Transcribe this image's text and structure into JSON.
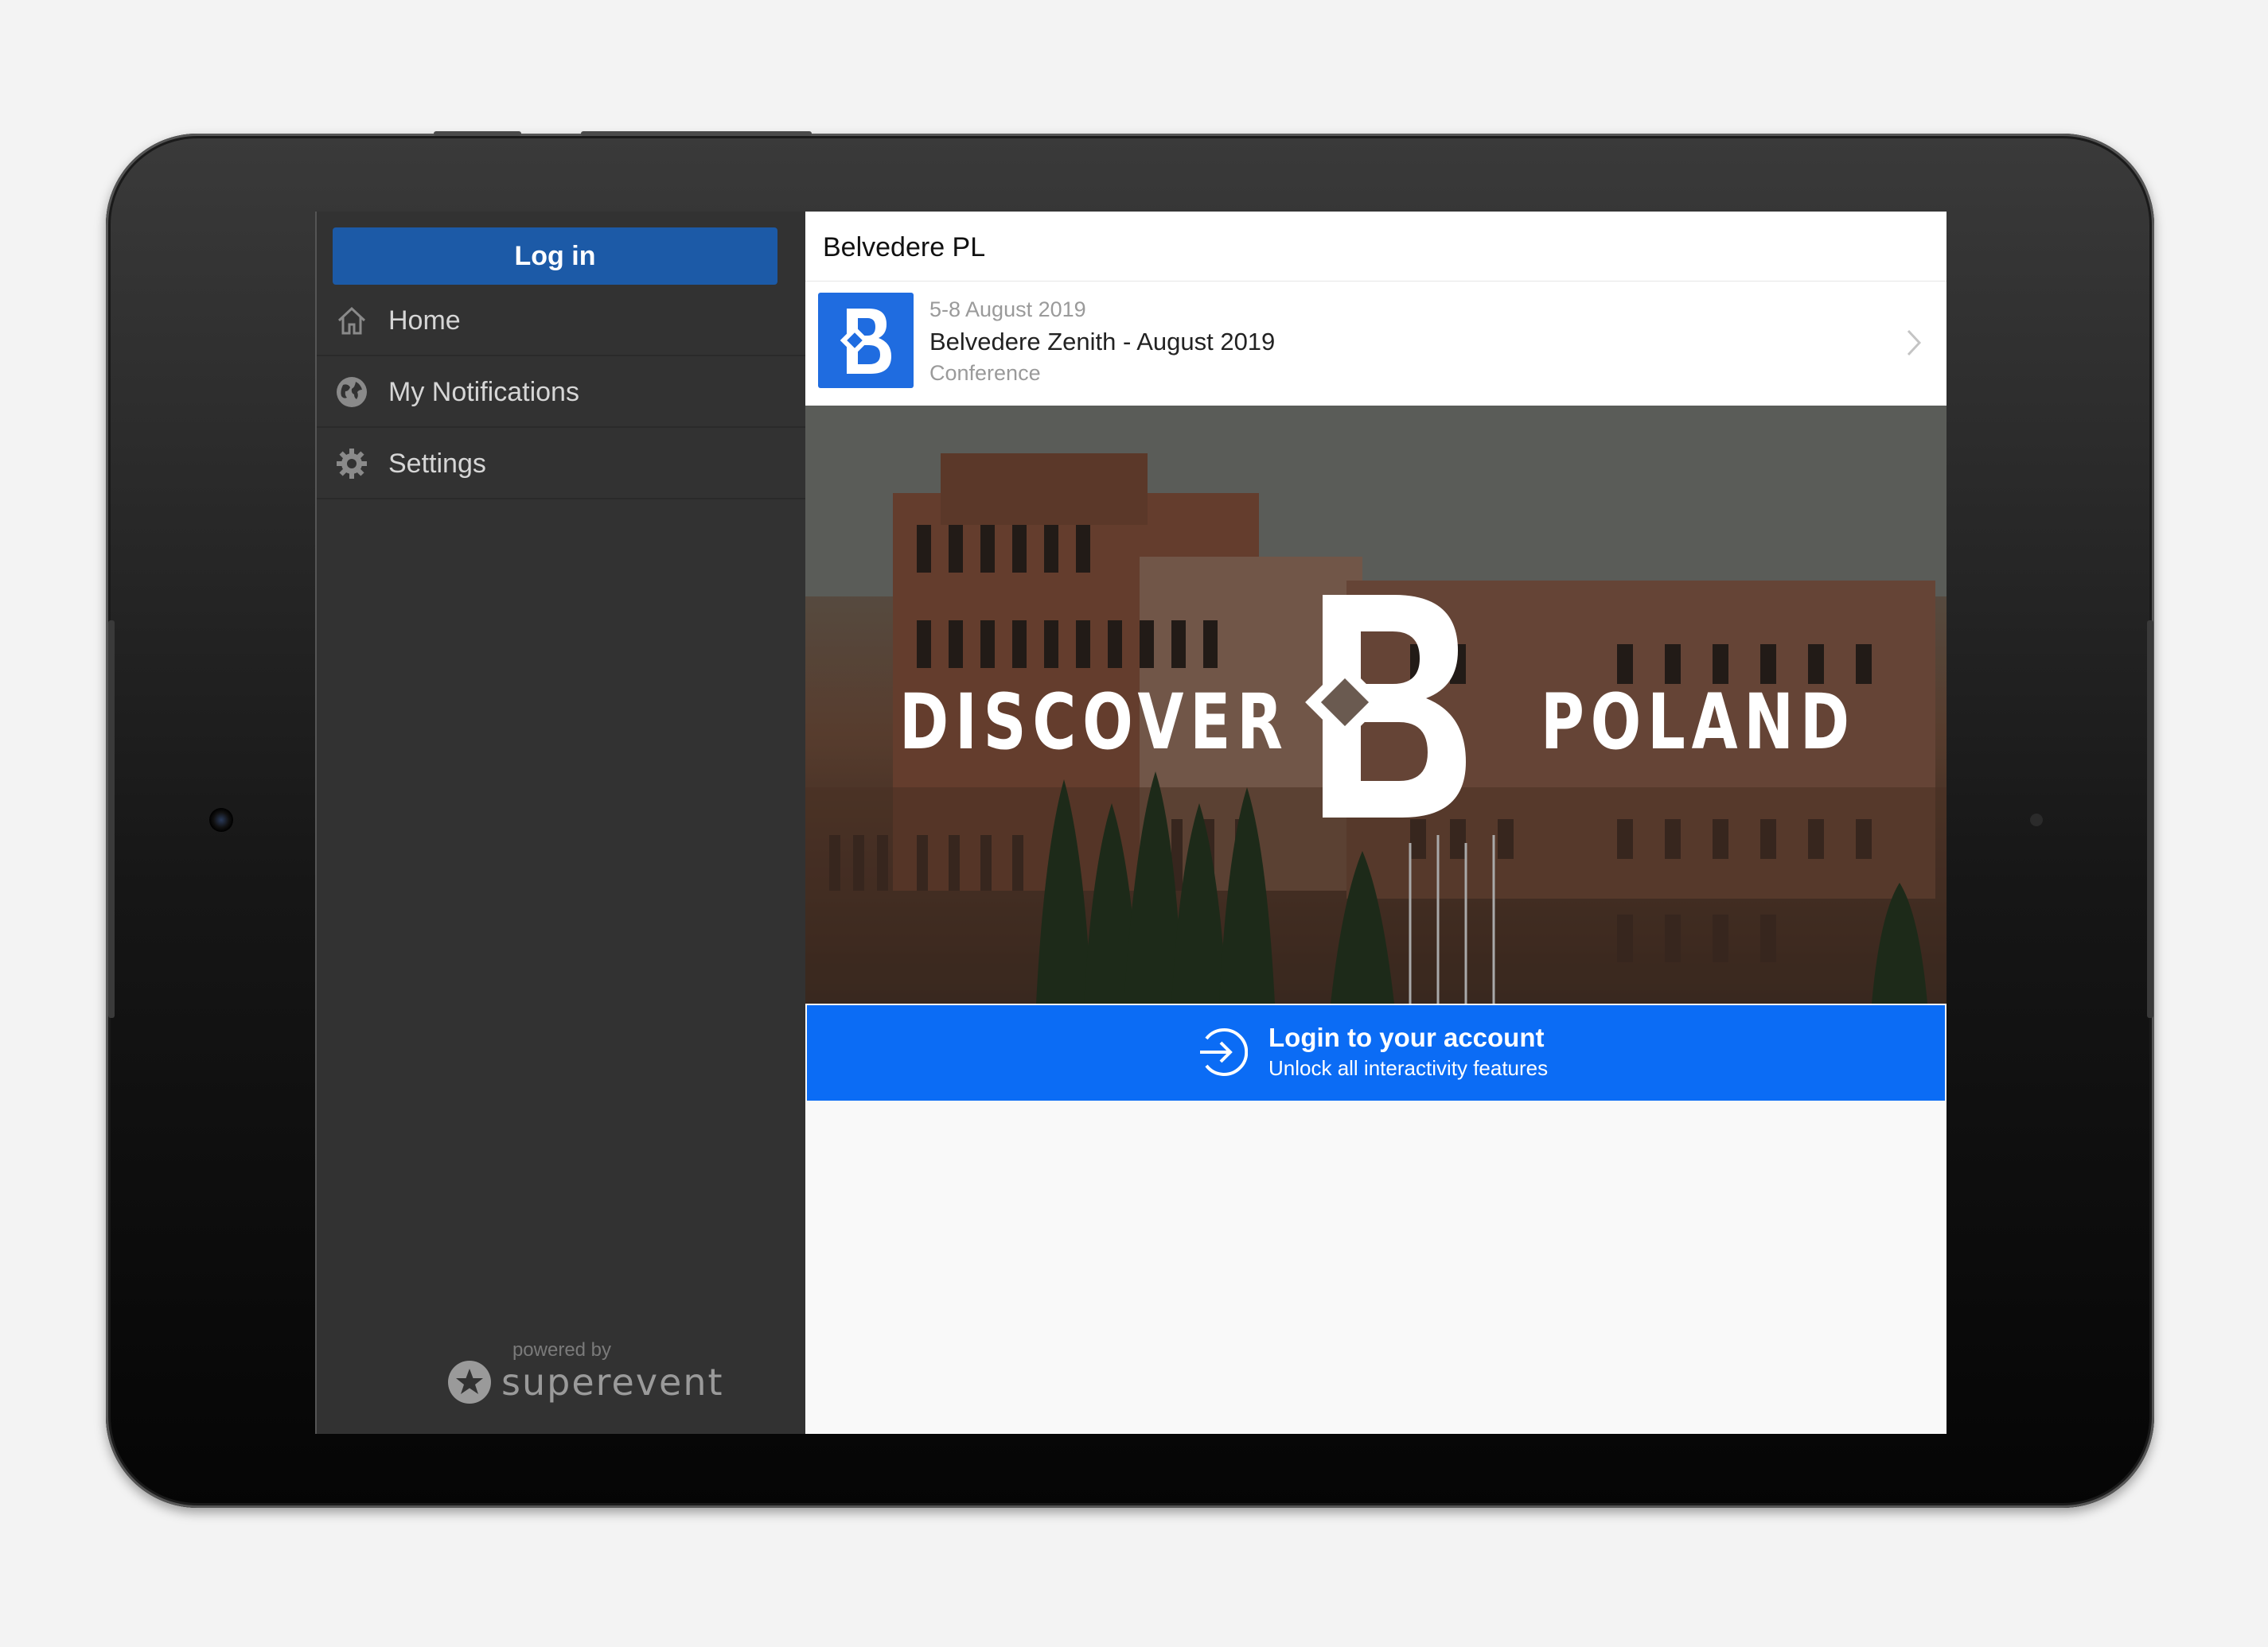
{
  "sidebar": {
    "login_label": "Log in",
    "items": [
      {
        "label": "Home",
        "icon": "home-icon"
      },
      {
        "label": "My Notifications",
        "icon": "globe-icon"
      },
      {
        "label": "Settings",
        "icon": "gear-icon"
      }
    ],
    "powered_by": "powered by",
    "brand_name": "superevent"
  },
  "header": {
    "title": "Belvedere PL"
  },
  "event": {
    "dates": "5-8 August 2019",
    "name": "Belvedere Zenith - August 2019",
    "type": "Conference",
    "logo_letter": "B"
  },
  "hero": {
    "left_text": "DISCOVER",
    "right_text": "POLAND",
    "logo_letter": "B"
  },
  "cta": {
    "title": "Login to your account",
    "subtitle": "Unlock all interactivity features"
  },
  "colors": {
    "login_button": "#1c5aa7",
    "cta_background": "#0b6cf5",
    "event_logo": "#1f6ce0",
    "sidebar": "#323232"
  }
}
